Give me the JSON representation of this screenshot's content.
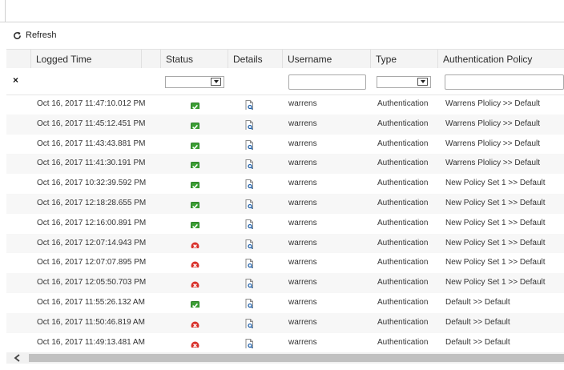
{
  "toolbar": {
    "refresh_label": "Refresh",
    "refresh_icon": "refresh-icon"
  },
  "columns": {
    "logged_time": "Logged Time",
    "status": "Status",
    "details": "Details",
    "username": "Username",
    "type": "Type",
    "auth_policy": "Authentication Policy"
  },
  "filters": {
    "clear_label": "×",
    "status_value": "",
    "username_value": "",
    "type_value": "",
    "policy_value": ""
  },
  "colors": {
    "success": "#3c9e35",
    "failure": "#d9312b",
    "row_alt": "#f7f7f7",
    "header_bg": "#f4f4f4"
  },
  "rows": [
    {
      "time": "Oct 16, 2017 11:47:10.012 PM",
      "status": "success",
      "username": "warrens",
      "type": "Authentication",
      "policy": "Warrens Plolicy >> Default"
    },
    {
      "time": "Oct 16, 2017 11:45:12.451 PM",
      "status": "success",
      "username": "warrens",
      "type": "Authentication",
      "policy": "Warrens Plolicy >> Default"
    },
    {
      "time": "Oct 16, 2017 11:43:43.881 PM",
      "status": "success",
      "username": "warrens",
      "type": "Authentication",
      "policy": "Warrens Plolicy >> Default"
    },
    {
      "time": "Oct 16, 2017 11:41:30.191 PM",
      "status": "success",
      "username": "warrens",
      "type": "Authentication",
      "policy": "Warrens Plolicy >> Default"
    },
    {
      "time": "Oct 16, 2017 10:32:39.592 PM",
      "status": "success",
      "username": "warrens",
      "type": "Authentication",
      "policy": "New Policy Set 1 >> Default"
    },
    {
      "time": "Oct 16, 2017 12:18:28.655 PM",
      "status": "success",
      "username": "warrens",
      "type": "Authentication",
      "policy": "New Policy Set 1 >> Default"
    },
    {
      "time": "Oct 16, 2017 12:16:00.891 PM",
      "status": "success",
      "username": "warrens",
      "type": "Authentication",
      "policy": "New Policy Set 1 >> Default"
    },
    {
      "time": "Oct 16, 2017 12:07:14.943 PM",
      "status": "failure",
      "username": "warrens",
      "type": "Authentication",
      "policy": "New Policy Set 1 >> Default"
    },
    {
      "time": "Oct 16, 2017 12:07:07.895 PM",
      "status": "failure",
      "username": "warrens",
      "type": "Authentication",
      "policy": "New Policy Set 1 >> Default"
    },
    {
      "time": "Oct 16, 2017 12:05:50.703 PM",
      "status": "failure",
      "username": "warrens",
      "type": "Authentication",
      "policy": "New Policy Set 1 >> Default"
    },
    {
      "time": "Oct 16, 2017 11:55:26.132 AM",
      "status": "success",
      "username": "warrens",
      "type": "Authentication",
      "policy": "Default >> Default"
    },
    {
      "time": "Oct 16, 2017 11:50:46.819 AM",
      "status": "failure",
      "username": "warrens",
      "type": "Authentication",
      "policy": "Default >> Default"
    },
    {
      "time": "Oct 16, 2017 11:49:13.481 AM",
      "status": "failure",
      "username": "warrens",
      "type": "Authentication",
      "policy": "Default >> Default"
    }
  ]
}
